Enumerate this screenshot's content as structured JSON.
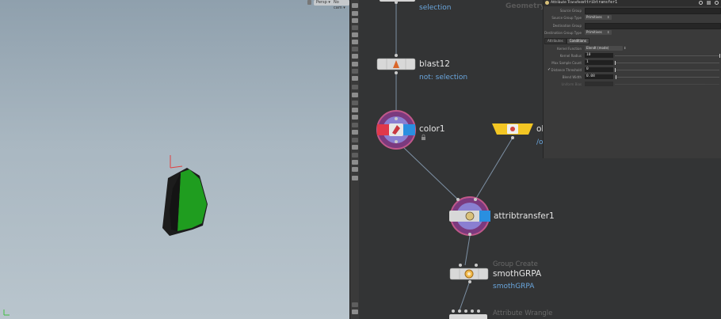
{
  "viewport": {
    "pills": [
      "Persp ▾",
      "No cam ▾"
    ],
    "axis_label": "y"
  },
  "nodes": {
    "top_sub": "selection",
    "blast": {
      "name": "blast12",
      "sub": "not: selection"
    },
    "color": {
      "name": "color1"
    },
    "partial": {
      "name": "ol",
      "sub": "/o"
    },
    "attrib": {
      "name": "attribtransfer1"
    },
    "group": {
      "type": "Group Create",
      "name": "smothGRPA",
      "sub": "smothGRPA"
    },
    "wrangle": {
      "type": "Attribute Wrangle"
    },
    "context": "Geometry"
  },
  "panel": {
    "title": "Attribute Transfer",
    "name": "attribtransfer1",
    "rows": [
      {
        "label": "Source Group",
        "kind": "field"
      },
      {
        "label": "Source Group Type",
        "kind": "drop",
        "value": "Primitives"
      },
      {
        "label": "Destination Group",
        "kind": "field"
      },
      {
        "label": "Destination Group Type",
        "kind": "drop",
        "value": "Primitives"
      }
    ],
    "tabs": [
      "Attributes",
      "Conditions"
    ],
    "cond_rows": [
      {
        "label": "Kernel Function",
        "kind": "drop",
        "value": "Elendt (mode)"
      },
      {
        "label": "Kernel Radius",
        "kind": "num",
        "value": "10"
      },
      {
        "label": "Max Sample Count",
        "kind": "num",
        "value": "1"
      },
      {
        "label": "Distance Threshold",
        "kind": "num",
        "value": "0"
      },
      {
        "label": "Blend Width",
        "kind": "num",
        "value": "0.08"
      },
      {
        "label": "Uniform Bias",
        "kind": "dim"
      }
    ]
  }
}
